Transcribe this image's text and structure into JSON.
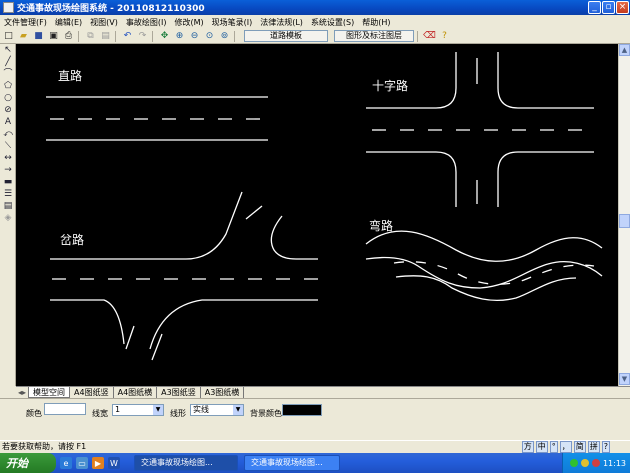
{
  "window": {
    "title": "交通事故现场绘图系统 - 20110812110300",
    "controls": [
      "minimize",
      "maximize",
      "close"
    ]
  },
  "menu": [
    "文件管理(F)",
    "编辑(E)",
    "视图(V)",
    "事故绘图(I)",
    "修改(M)",
    "现场笔录(I)",
    "法律法规(L)",
    "系统设置(S)",
    "帮助(H)"
  ],
  "toolbar": {
    "icons": [
      "new-file-icon",
      "open-folder-icon",
      "save-icon",
      "print-preview-icon",
      "print-icon",
      "copy-icon",
      "paste-icon",
      "undo-icon",
      "redo-icon",
      "pan-icon",
      "zoom-in-icon",
      "zoom-out-icon",
      "zoom-window-icon",
      "zoom-extents-icon"
    ],
    "road_template_button": "道路模板",
    "layer_button": "图形及标注图层",
    "extra_icons": [
      "eraser-icon",
      "help-icon"
    ]
  },
  "left_tools": [
    "select-arrow-icon",
    "line-icon",
    "arc-icon",
    "polygon-icon",
    "circle-icon",
    "ellipse-icon",
    "text-icon",
    "arrow-curve-icon",
    "dimension-icon",
    "double-arrow-icon",
    "single-arrow-icon",
    "thick-line-icon",
    "hatch-icon",
    "layers-icon",
    "eraser-icon"
  ],
  "canvas": {
    "labels": {
      "straight": "直路",
      "crossroad": "十字路",
      "fork": "岔路",
      "curve": "弯路"
    }
  },
  "sheet_tabs": [
    {
      "label": "模型空间",
      "active": true
    },
    {
      "label": "A4图纸竖",
      "active": false
    },
    {
      "label": "A4图纸横",
      "active": false
    },
    {
      "label": "A3图纸竖",
      "active": false
    },
    {
      "label": "A3图纸横",
      "active": false
    }
  ],
  "properties": {
    "color_label": "颜色",
    "color_value": "",
    "linewidth_label": "线宽",
    "linewidth_value": "1",
    "linetype_label": "线形",
    "linetype_value": "实线",
    "bgcolor_label": "背景颜色",
    "bgcolor_value": "#000000"
  },
  "status": {
    "text": "若要获取帮助，请按 F1",
    "ime": [
      "方",
      "中",
      "°",
      "，",
      "简",
      "拼",
      "?"
    ]
  },
  "taskbar": {
    "start_label": "开始",
    "quicklaunch": [
      "ie-icon",
      "show-desktop-icon",
      "media-player-icon",
      "word-icon"
    ],
    "tasks": [
      {
        "label": "交通事故现场绘图...",
        "active": true
      },
      {
        "label": "交通事故现场绘图...",
        "active": false
      }
    ],
    "clock": "11:13"
  },
  "colors": {
    "canvas_bg": "#000000",
    "road_line": "#ffffff",
    "titlebar": "#0848c0",
    "taskbar": "#245edb",
    "start_button": "#2f8a2f"
  }
}
